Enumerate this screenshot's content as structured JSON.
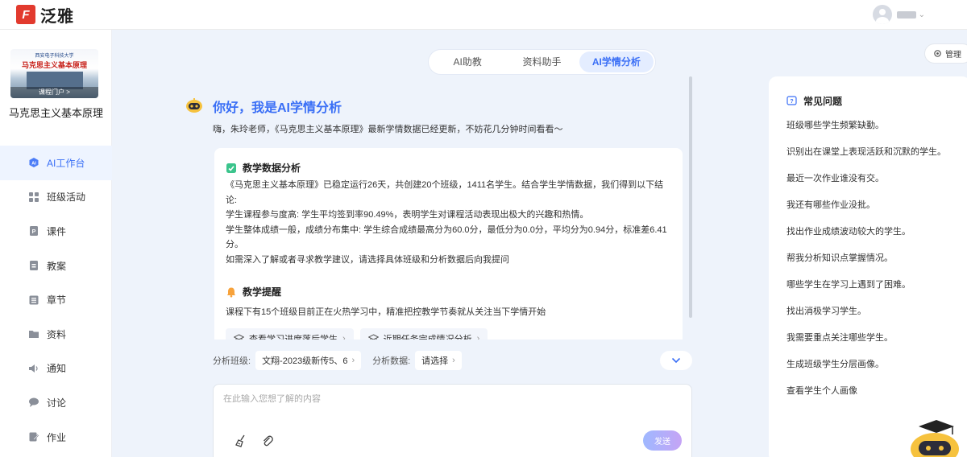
{
  "brand": {
    "name": "泛雅"
  },
  "course": {
    "cover_university": "西安电子科技大学",
    "cover_title": "马克思主义基本原理",
    "cover_link": "课程门户 >",
    "name": "马克思主义基本原理"
  },
  "nav": [
    {
      "label": "AI工作台",
      "icon": "ai-icon",
      "active": true
    },
    {
      "label": "班级活动",
      "icon": "grid-icon"
    },
    {
      "label": "课件",
      "icon": "ppt-icon"
    },
    {
      "label": "教案",
      "icon": "lesson-plan-icon"
    },
    {
      "label": "章节",
      "icon": "chapter-icon"
    },
    {
      "label": "资料",
      "icon": "folder-icon"
    },
    {
      "label": "通知",
      "icon": "speaker-icon"
    },
    {
      "label": "讨论",
      "icon": "chat-icon"
    },
    {
      "label": "作业",
      "icon": "homework-icon"
    }
  ],
  "tabs": [
    {
      "label": "AI助教"
    },
    {
      "label": "资料助手"
    },
    {
      "label": "AI学情分析",
      "active": true
    }
  ],
  "manage_label": "管理",
  "chat": {
    "greet_title": "你好，我是AI学情分析",
    "greet_sub": "嗨，朱玲老师，《马克思主义基本原理》最新学情数据已经更新，不妨花几分钟时间看看～",
    "analysis": {
      "title": "教学数据分析",
      "lines": [
        "《马克思主义基本原理》已稳定运行26天，共创建20个班级，1411名学生。结合学生学情数据，我们得到以下结论:",
        "学生课程参与度高: 学生平均签到率90.49%，表明学生对课程活动表现出极大的兴趣和热情。",
        "学生整体成绩一般，成绩分布集中: 学生综合成绩最高分为60.0分，最低分为0.0分，平均分为0.94分，标准差6.41分。",
        "如需深入了解或者寻求教学建议，请选择具体班级和分析数据后向我提问"
      ]
    },
    "reminder": {
      "title": "教学提醒",
      "text": "课程下有15个班级目前正在火热学习中，精准把控教学节奏就从关注当下学情开始",
      "chips": [
        "查看学习进度落后学生",
        "近期任务完成情况分析"
      ]
    }
  },
  "filters": {
    "class_label": "分析班级:",
    "class_value": "文翔-2023级新传5、6",
    "data_label": "分析数据:",
    "data_value": "请选择"
  },
  "input": {
    "placeholder": "在此输入您想了解的内容",
    "send_label": "发送"
  },
  "faq": {
    "title": "常见问题",
    "items": [
      "班级哪些学生频繁缺勤。",
      "识别出在课堂上表现活跃和沉默的学生。",
      "最近一次作业谁没有交。",
      "我还有哪些作业没批。",
      "找出作业成绩波动较大的学生。",
      "帮我分析知识点掌握情况。",
      "哪些学生在学习上遇到了困难。",
      "找出消极学习学生。",
      "我需要重点关注哪些学生。",
      "生成班级学生分层画像。",
      "查看学生个人画像"
    ]
  },
  "colors": {
    "accent": "#3a6ff6",
    "brand": "#e23a2e"
  }
}
